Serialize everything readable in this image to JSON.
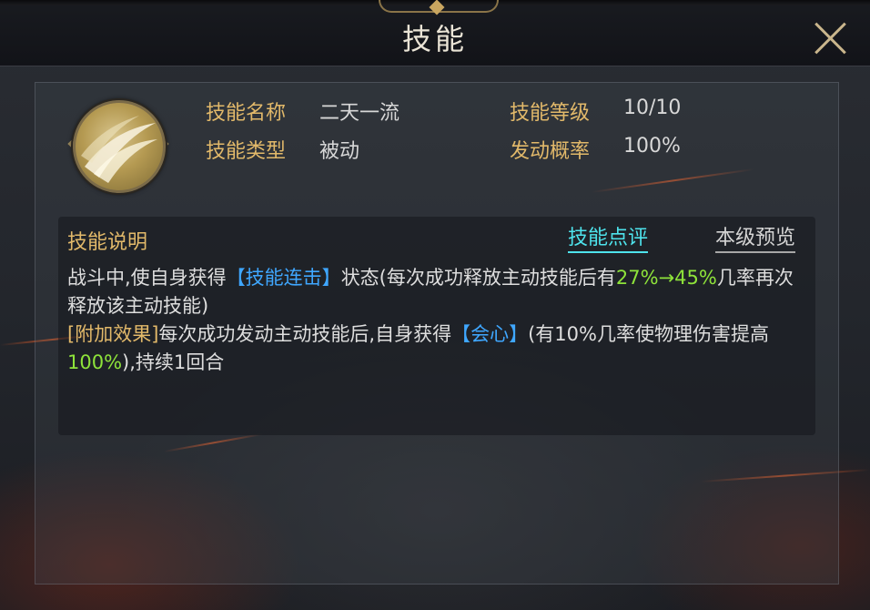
{
  "dialog": {
    "title": "技能",
    "close_icon": "close-icon"
  },
  "skill": {
    "icon": "sword-slash-icon",
    "name_label": "技能名称",
    "name_value": "二天一流",
    "level_label": "技能等级",
    "level_value": "10/10",
    "type_label": "技能类型",
    "type_value": "被动",
    "chance_label": "发动概率",
    "chance_value": "100%"
  },
  "description": {
    "title": "技能说明",
    "tab_review": "技能点评",
    "tab_preview": "本级预览",
    "line1_a": "战斗中,使自身获得",
    "line1_kw": "【技能连击】",
    "line1_b": "状态(每次成功释放主动技能后有",
    "line1_num1": "27%→45%",
    "line1_c": "几率再次释放该主动技能)",
    "line2_tag": "[附加效果]",
    "line2_a": "每次成功发动主动技能后,自身获得",
    "line2_kw": "【会心】",
    "line2_b": "(有10%几率使物理伤害提高",
    "line2_num": "100%",
    "line2_c": "),持续1回合"
  },
  "colors": {
    "label_gold": "#e2b96a",
    "keyword_blue": "#3fa7ff",
    "number_green": "#8ee33a",
    "tab_active_cyan": "#4ee3ec"
  }
}
